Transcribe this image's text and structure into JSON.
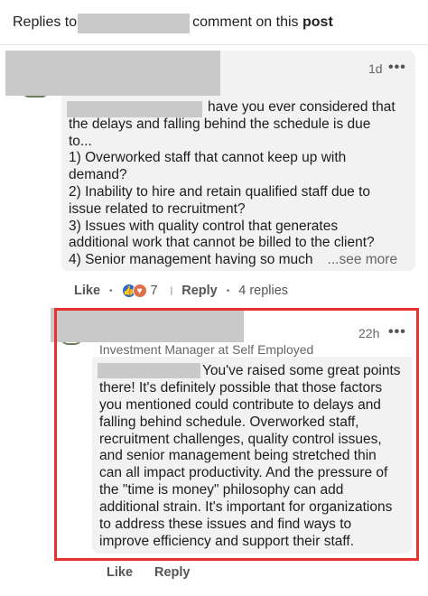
{
  "header": {
    "prefix": "Replies to",
    "middle": "comment on this",
    "post_word": "post"
  },
  "comment": {
    "time": "1d",
    "more_glyph": "•••",
    "lines": [
      "have you ever considered that",
      "the delays and falling behind the schedule is due",
      "to...",
      "1) Overworked staff that cannot keep up with",
      "demand?",
      "2) Inability to hire and retain qualified staff due to",
      "issue related to recruitment?",
      "3) Issues with quality control that generates",
      "additional work that cannot be billed to the client?",
      "4) Senior management having so much"
    ],
    "see_more": "...see more",
    "actions": {
      "like": "Like",
      "reaction_count": "7",
      "reply": "Reply",
      "replies": "4 replies"
    },
    "reaction_icons": [
      "like-icon",
      "love-icon"
    ]
  },
  "reply": {
    "headline": "Investment Manager at Self Employed",
    "time": "22h",
    "more_glyph": "•••",
    "lines": [
      "You've raised some great points",
      "there! It's definitely possible that those factors",
      "you mentioned could contribute to delays and",
      "falling behind schedule. Overworked staff,",
      "recruitment challenges, quality control issues,",
      "and senior management being stretched thin",
      "can all impact productivity. And the pressure of",
      "the \"time is money\" philosophy can add",
      "additional strain. It's important for organizations",
      "to address these issues and find ways to",
      "improve efficiency and support their staff."
    ],
    "actions": {
      "like": "Like",
      "reply": "Reply"
    }
  },
  "colors": {
    "highlight_border": "#e8322f",
    "bubble_bg": "#f2f2f2",
    "redaction": "#c9c9c9",
    "like_blue": "#2b6cc4",
    "love_red": "#df704d"
  }
}
